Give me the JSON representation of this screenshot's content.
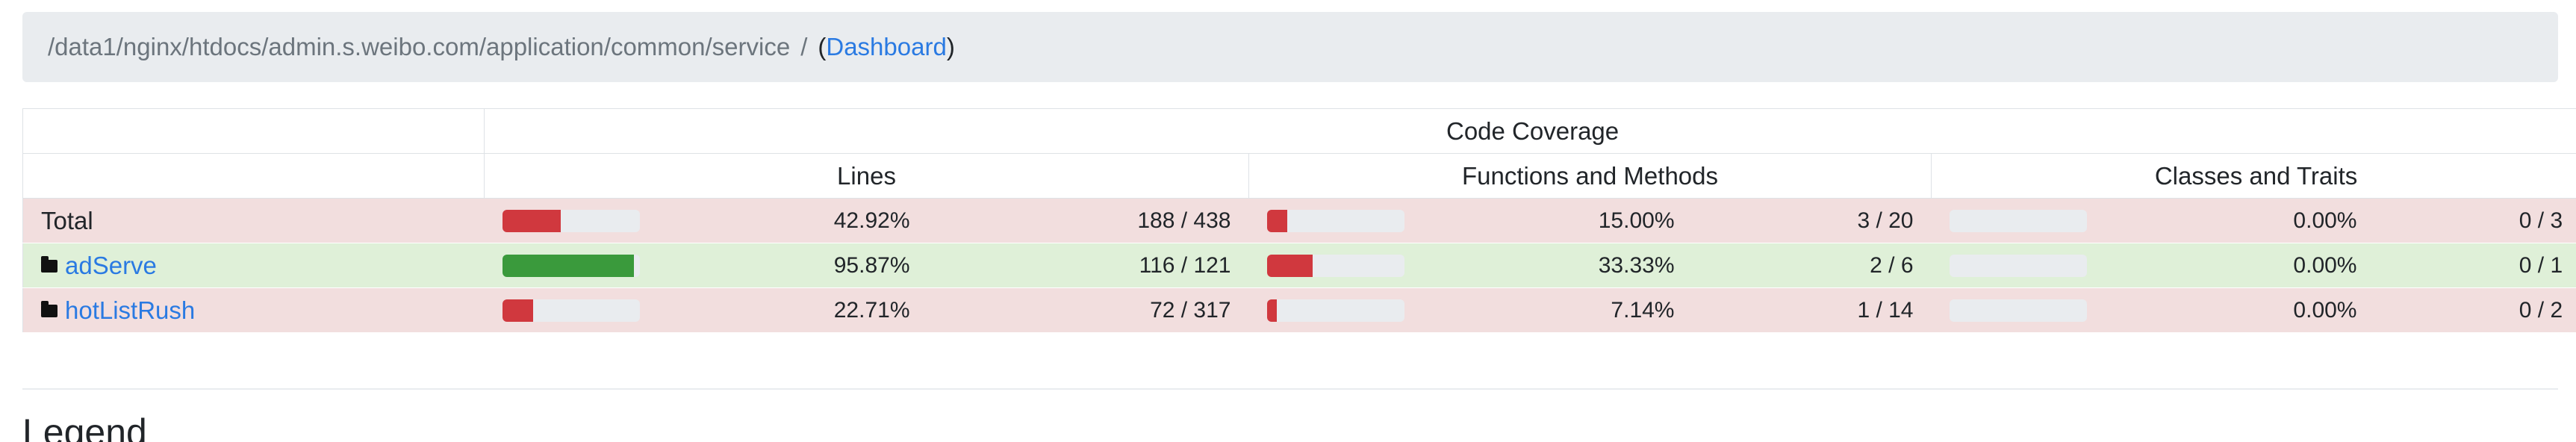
{
  "breadcrumb": {
    "path": "/data1/nginx/htdocs/admin.s.weibo.com/application/common/service",
    "separator": "/",
    "open_paren": "(",
    "dashboard_link": "Dashboard",
    "close_paren": ")"
  },
  "table": {
    "header_main": "Code Coverage",
    "header_lines": "Lines",
    "header_functions": "Functions and Methods",
    "header_classes": "Classes and Traits",
    "rows": [
      {
        "name": "Total",
        "is_link": false,
        "status": "danger",
        "lines": {
          "fraction": 0.4292,
          "percent": "42.92%",
          "count": "188 / 438"
        },
        "functions": {
          "fraction": 0.15,
          "percent": "15.00%",
          "count": "3 / 20"
        },
        "classes": {
          "fraction": 0.0,
          "percent": "0.00%",
          "count": "0 / 3"
        }
      },
      {
        "name": "adServe",
        "is_link": true,
        "status": "success",
        "lines": {
          "fraction": 0.9587,
          "percent": "95.87%",
          "count": "116 / 121"
        },
        "functions": {
          "fraction": 0.3333,
          "percent": "33.33%",
          "count": "2 / 6"
        },
        "classes": {
          "fraction": 0.0,
          "percent": "0.00%",
          "count": "0 / 1"
        }
      },
      {
        "name": "hotListRush",
        "is_link": true,
        "status": "danger",
        "lines": {
          "fraction": 0.2271,
          "percent": "22.71%",
          "count": "72 / 317"
        },
        "functions": {
          "fraction": 0.0714,
          "percent": "7.14%",
          "count": "1 / 14"
        },
        "classes": {
          "fraction": 0.0,
          "percent": "0.00%",
          "count": "0 / 2"
        }
      }
    ]
  },
  "legend": {
    "title": "Legend"
  },
  "colors": {
    "low": "#d0383e",
    "high": "#3a9a3c",
    "danger_bg": "#f2dede",
    "success_bg": "#dff0d8",
    "link": "#2a7ae2"
  }
}
